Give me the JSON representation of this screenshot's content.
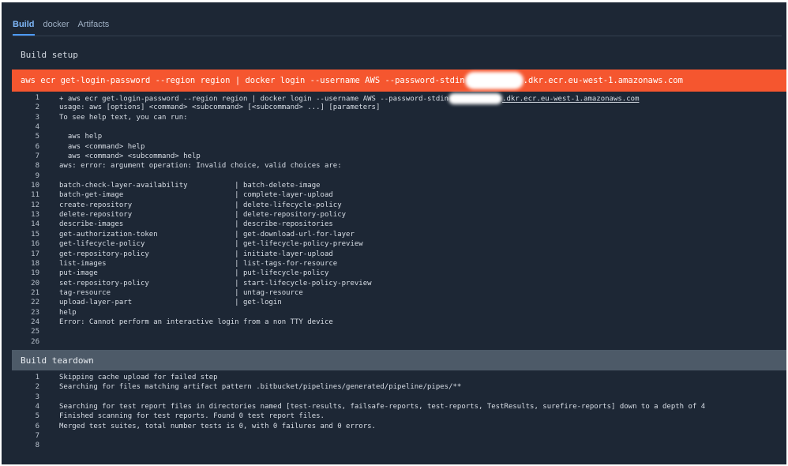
{
  "tabs": [
    {
      "label": "Build",
      "active": true
    },
    {
      "label": "docker",
      "active": false
    },
    {
      "label": "Artifacts",
      "active": false
    }
  ],
  "build_setup": {
    "title": "Build setup",
    "error_command_part1": "aws ecr get-login-password --region region | docker login --username AWS --password-stdin",
    "error_command_part2": ".dkr.ecr.eu-west-1.amazonaws.com"
  },
  "build_log": [
    {
      "n": "1",
      "text": "+ aws ecr get-login-password --region region | docker login --username AWS --password-stdin",
      "link": ".dkr.ecr.eu-west-1.amazonaws.com"
    },
    {
      "n": "2",
      "text": "usage: aws [options] <command> <subcommand> [<subcommand> ...] [parameters]"
    },
    {
      "n": "3",
      "text": "To see help text, you can run:"
    },
    {
      "n": "4",
      "text": ""
    },
    {
      "n": "5",
      "text": "  aws help"
    },
    {
      "n": "6",
      "text": "  aws <command> help"
    },
    {
      "n": "7",
      "text": "  aws <command> <subcommand> help"
    },
    {
      "n": "8",
      "text": "aws: error: argument operation: Invalid choice, valid choices are:"
    },
    {
      "n": "9",
      "text": ""
    },
    {
      "n": "10",
      "text": "batch-check-layer-availability           | batch-delete-image"
    },
    {
      "n": "11",
      "text": "batch-get-image                          | complete-layer-upload"
    },
    {
      "n": "12",
      "text": "create-repository                        | delete-lifecycle-policy"
    },
    {
      "n": "13",
      "text": "delete-repository                        | delete-repository-policy"
    },
    {
      "n": "14",
      "text": "describe-images                          | describe-repositories"
    },
    {
      "n": "15",
      "text": "get-authorization-token                  | get-download-url-for-layer"
    },
    {
      "n": "16",
      "text": "get-lifecycle-policy                     | get-lifecycle-policy-preview"
    },
    {
      "n": "17",
      "text": "get-repository-policy                    | initiate-layer-upload"
    },
    {
      "n": "18",
      "text": "list-images                              | list-tags-for-resource"
    },
    {
      "n": "19",
      "text": "put-image                                | put-lifecycle-policy"
    },
    {
      "n": "20",
      "text": "set-repository-policy                    | start-lifecycle-policy-preview"
    },
    {
      "n": "21",
      "text": "tag-resource                             | untag-resource"
    },
    {
      "n": "22",
      "text": "upload-layer-part                        | get-login"
    },
    {
      "n": "23",
      "text": "help"
    },
    {
      "n": "24",
      "text": "Error: Cannot perform an interactive login from a non TTY device"
    },
    {
      "n": "25",
      "text": ""
    },
    {
      "n": "26",
      "text": ""
    }
  ],
  "build_teardown": {
    "title": "Build teardown"
  },
  "teardown_log": [
    {
      "n": "1",
      "text": "Skipping cache upload for failed step"
    },
    {
      "n": "2",
      "text": "Searching for files matching artifact pattern .bitbucket/pipelines/generated/pipeline/pipes/**"
    },
    {
      "n": "3",
      "text": ""
    },
    {
      "n": "4",
      "text": "Searching for test report files in directories named [test-results, failsafe-reports, test-reports, TestResults, surefire-reports] down to a depth of 4"
    },
    {
      "n": "5",
      "text": "Finished scanning for test reports. Found 0 test report files."
    },
    {
      "n": "6",
      "text": "Merged test suites, total number tests is 0, with 0 failures and 0 errors."
    },
    {
      "n": "7",
      "text": ""
    },
    {
      "n": "8",
      "text": ""
    }
  ]
}
